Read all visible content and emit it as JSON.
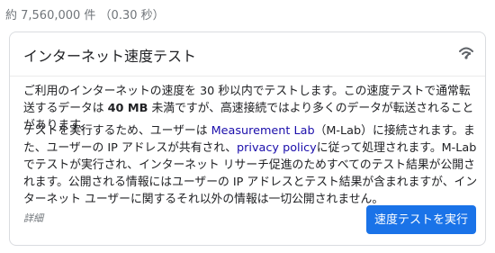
{
  "result_stats": "約 7,560,000 件 （0.30 秒）",
  "card": {
    "title": "インターネット速度テスト",
    "para1": {
      "before": "ご利用のインターネットの速度を 30 秒以内でテストします。この速度テストで通常転送するデータは ",
      "bold": "40 MB",
      "after": " 未満ですが、高速接続ではより多くのデータが転送されることがあります。"
    },
    "para2": {
      "part1": "テストを実行するため、ユーザーは ",
      "link1": "Measurement Lab",
      "part2": "（M-Lab）に接続されます。また、ユーザーの IP アドレスが共有され、",
      "link2": "privacy policy",
      "part3": "に従って処理されます。M-Lab でテストが実行され、インターネット リサーチ促進のためすべてのテスト結果が公開されます。公開される情報にはユーザーの IP アドレスとテスト結果が含まれますが、インターネット ユーザーに関するそれ以外の情報は一切公開されません。"
    },
    "details_label": "詳細",
    "run_button": "速度テストを実行"
  },
  "icons": {
    "header_icon": "wifi-signal-icon"
  },
  "colors": {
    "accent": "#1a73e8",
    "link": "#1a0dab"
  }
}
